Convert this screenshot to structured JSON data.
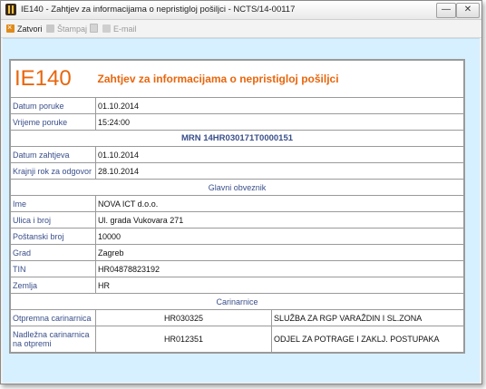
{
  "window": {
    "title": "IE140 - Zahtjev za informacijama o nepristigloj pošiljci - NCTS/14-00117",
    "min_label": "—",
    "close_label": "✕"
  },
  "toolbar": {
    "items": [
      {
        "label": "Zatvori",
        "icon": "close-icon",
        "enabled": true
      },
      {
        "label": "Štampaj",
        "icon": "print-icon",
        "enabled": false
      },
      {
        "label": "",
        "icon": "pdf-icon",
        "enabled": false
      },
      {
        "label": "E-mail",
        "icon": "mail-icon",
        "enabled": false
      }
    ]
  },
  "document": {
    "code": "IE140",
    "heading": "Zahtjev za informacijama o nepristigloj pošiljci",
    "rows1": [
      {
        "label": "Datum poruke",
        "value": "01.10.2014"
      },
      {
        "label": "Vrijeme poruke",
        "value": "15:24:00"
      }
    ],
    "mrn": "MRN 14HR030171T0000151",
    "rows2": [
      {
        "label": "Datum zahtjeva",
        "value": "01.10.2014"
      },
      {
        "label": "Krajnji rok za odgovor",
        "value": "28.10.2014"
      }
    ],
    "principal_section": "Glavni obveznik",
    "principal": [
      {
        "label": "Ime",
        "value": "NOVA ICT d.o.o."
      },
      {
        "label": "Ulica i broj",
        "value": "Ul. grada Vukovara 271"
      },
      {
        "label": "Poštanski broj",
        "value": "10000"
      },
      {
        "label": "Grad",
        "value": "Zagreb"
      },
      {
        "label": "TIN",
        "value": "HR04878823192"
      },
      {
        "label": "Zemlja",
        "value": "HR"
      }
    ],
    "customs_section": "Carinarnice",
    "customs": [
      {
        "label": "Otpremna carinarnica",
        "code": "HR030325",
        "name": "SLUŽBA ZA RGP VARAŽDIN I SL.ZONA"
      },
      {
        "label": "Nadležna carinarnica na otpremi",
        "code": "HR012351",
        "name": "ODJEL ZA POTRAGE I ZAKLJ. POSTUPAKA"
      }
    ]
  },
  "colors": {
    "accent_orange": "#e8660d",
    "label_blue": "#3a4f8a",
    "content_bg": "#d7f0ff"
  }
}
